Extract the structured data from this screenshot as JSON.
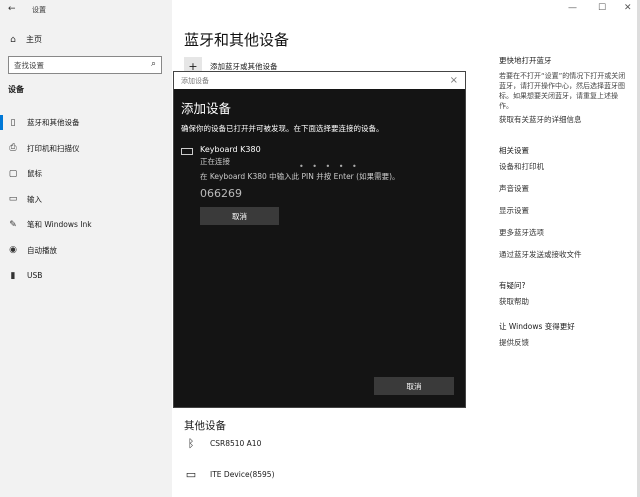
{
  "app": {
    "title": "设置"
  },
  "sidebar": {
    "home_label": "主页",
    "search_placeholder": "查找设置",
    "section_label": "设备",
    "items": [
      {
        "label": "蓝牙和其他设备",
        "icon": "bluetooth-devices-icon"
      },
      {
        "label": "打印机和扫描仪",
        "icon": "printer-icon"
      },
      {
        "label": "鼠标",
        "icon": "mouse-icon"
      },
      {
        "label": "输入",
        "icon": "keyboard-icon"
      },
      {
        "label": "笔和 Windows Ink",
        "icon": "pen-icon"
      },
      {
        "label": "自动播放",
        "icon": "autoplay-icon"
      },
      {
        "label": "USB",
        "icon": "usb-icon"
      }
    ]
  },
  "main": {
    "title": "蓝牙和其他设备",
    "add_device_label": "添加蓝牙或其他设备",
    "other_devices_title": "其他设备",
    "devices": [
      {
        "name": "CSR8510 A10",
        "icon": "bluetooth-icon"
      },
      {
        "name": "ITE Device(8595)",
        "icon": "device-icon"
      }
    ]
  },
  "right_panel": {
    "quick_title": "更快地打开蓝牙",
    "quick_text": "若要在不打开“设置”的情况下打开或关闭蓝牙，请打开操作中心，然后选择蓝牙图标。如果想要关闭蓝牙，请重复上述操作。",
    "quick_link": "获取有关蓝牙的详细信息",
    "related_title": "相关设置",
    "related_links": [
      "设备和打印机",
      "声音设置",
      "显示设置",
      "更多蓝牙选项",
      "通过蓝牙发送或接收文件"
    ],
    "question_title": "有疑问?",
    "help_link": "获取帮助",
    "improve_title": "让 Windows 变得更好",
    "feedback_link": "提供反馈"
  },
  "dialog": {
    "window_title": "添加设备",
    "title": "添加设备",
    "description": "确保你的设备已打开并可被发现。在下面选择要连接的设备。",
    "device_name": "Keyboard K380",
    "device_status": "正在连接",
    "pin_instruction": "在 Keyboard K380 中输入此 PIN 并按 Enter (如果需要)。",
    "pin": "066269",
    "cancel_label": "取消",
    "cancel_bottom_label": "取消",
    "close_glyph": "×"
  },
  "window_controls": {
    "minimize": "—",
    "maximize": "☐",
    "close": "✕"
  }
}
